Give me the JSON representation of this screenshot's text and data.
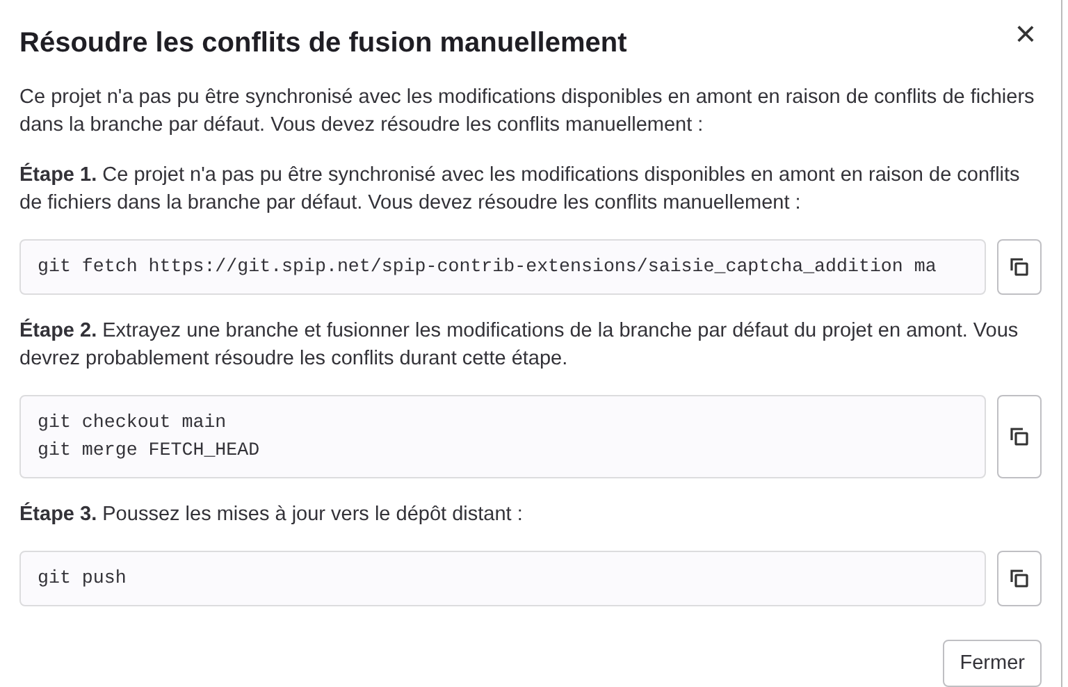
{
  "dialog": {
    "title": "Résoudre les conflits de fusion manuellement",
    "close": "×",
    "intro": "Ce projet n'a pas pu être synchronisé avec les modifications disponibles en amont en raison de conflits de fichiers dans la branche par défaut. Vous devez résoudre les conflits manuellement :",
    "steps": [
      {
        "text": "**Étape 1.** Ce projet n'a pas pu être synchronisé avec les modifications disponibles en amont en raison de conflits de fichiers dans la branche par défaut. Vous devez résoudre les conflits manuellement :",
        "code": [
          "git fetch https://git.spip.net/spip-contrib-extensions/saisie_captcha_addition ma"
        ]
      },
      {
        "text": "**Étape 2.** Extrayez une branche et fusionner les modifications de la branche par défaut du projet en amont. Vous devrez probablement résoudre les conflits durant cette étape.",
        "code": [
          "git checkout main",
          "git merge FETCH_HEAD"
        ]
      },
      {
        "text": "**Étape 3.** Poussez les mises à jour vers le dépôt distant :",
        "code": [
          "git push"
        ]
      }
    ],
    "footer_button": "Fermer"
  }
}
